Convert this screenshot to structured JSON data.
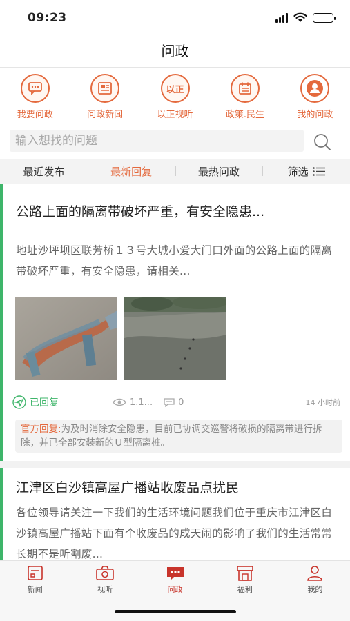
{
  "status_bar": {
    "time": "09:23"
  },
  "header": {
    "title": "问政"
  },
  "quick_actions": [
    {
      "label": "我要问政",
      "icon": "chat-bubble-icon"
    },
    {
      "label": "问政新闻",
      "icon": "newspaper-icon"
    },
    {
      "label": "以正视听",
      "icon": "yizheng-logo-icon",
      "badge": "以正"
    },
    {
      "label": "政策.民生",
      "icon": "calendar-icon"
    },
    {
      "label": "我的问政",
      "icon": "user-icon"
    }
  ],
  "search": {
    "placeholder": "输入想找的问题"
  },
  "filter_tabs": {
    "items": [
      "最近发布",
      "最新回复",
      "最热问政"
    ],
    "active": "最新回复",
    "filter_label": "筛选"
  },
  "posts": [
    {
      "title": "公路上面的隔离带破坏严重，有安全隐患...",
      "body": "地址沙坪坝区联芳桥１３号大城小爱大门口外面的公路上面的隔离带破坏严重，有安全隐患，请相关...",
      "status": "已回复",
      "views": "1.1...",
      "comments": "0",
      "time": "14 小时前",
      "reply_label": "官方回复:",
      "reply_text": "为及时消除安全隐患，目前已协调交巡警将破损的隔离带进行拆除，并已全部安装新的Ｕ型隔离桩。"
    },
    {
      "title": "江津区白沙镇高屋广播站收废品点扰民",
      "body": "各位领导请关注一下我们的生活环境问题我们位于重庆市江津区白沙镇高屋广播站下面有个收废品的成天闹的影响了我们的生活常常长期不是听割废..."
    }
  ],
  "tab_bar": {
    "items": [
      {
        "label": "新闻",
        "icon": "news-icon"
      },
      {
        "label": "视听",
        "icon": "camera-icon"
      },
      {
        "label": "问政",
        "icon": "message-icon"
      },
      {
        "label": "福利",
        "icon": "shop-icon"
      },
      {
        "label": "我的",
        "icon": "profile-icon"
      }
    ],
    "active": "问政"
  },
  "colors": {
    "accent": "#e4693d",
    "green": "#3eb56a",
    "tab_active": "#c8342b"
  }
}
